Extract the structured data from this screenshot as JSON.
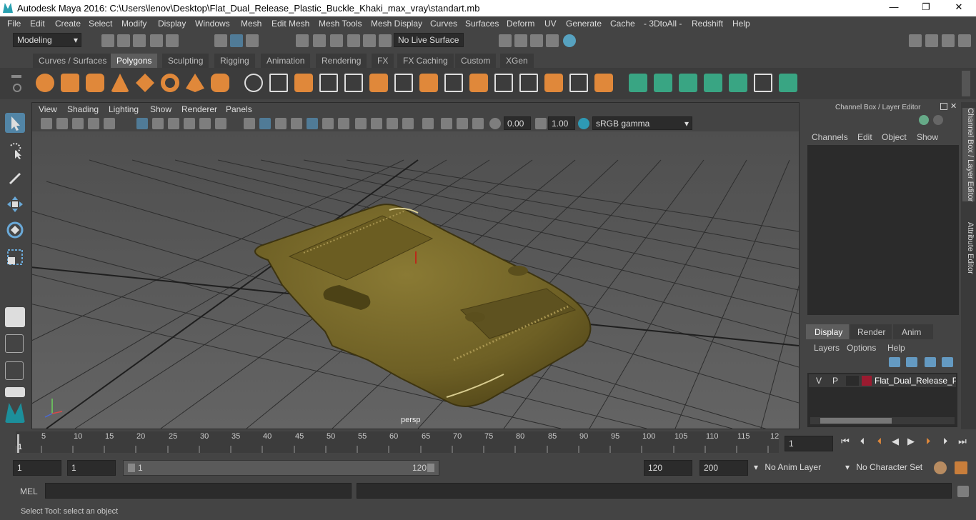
{
  "window": {
    "title": "Autodesk Maya 2016: C:\\Users\\lenov\\Desktop\\Flat_Dual_Release_Plastic_Buckle_Khaki_max_vray\\standart.mb",
    "minimize": "—",
    "restore": "❐",
    "close": "✕"
  },
  "menus": [
    "File",
    "Edit",
    "Create",
    "Select",
    "Modify",
    "Display",
    "Windows",
    "Mesh",
    "Edit Mesh",
    "Mesh Tools",
    "Mesh Display",
    "Curves",
    "Surfaces",
    "Deform",
    "UV",
    "Generate",
    "Cache",
    "- 3DtoAll -",
    "Redshift",
    "Help"
  ],
  "status": {
    "mode": "Modeling",
    "live_surface": "No Live Surface"
  },
  "shelf_tabs": [
    "Curves / Surfaces",
    "Polygons",
    "Sculpting",
    "Rigging",
    "Animation",
    "Rendering",
    "FX",
    "FX Caching",
    "Custom",
    "XGen"
  ],
  "active_shelf_tab": "Polygons",
  "viewport": {
    "menus": [
      "View",
      "Shading",
      "Lighting",
      "Show",
      "Renderer",
      "Panels"
    ],
    "exposure": "0.00",
    "gamma": "1.00",
    "color_space": "sRGB gamma",
    "camera_label": "persp"
  },
  "channel_box": {
    "title": "Channel Box / Layer Editor",
    "menus": [
      "Channels",
      "Edit",
      "Object",
      "Show"
    ]
  },
  "layer_editor": {
    "tabs": [
      "Display",
      "Render",
      "Anim"
    ],
    "menus": [
      "Layers",
      "Options",
      "Help"
    ],
    "layer": {
      "v": "V",
      "p": "P",
      "name": "Flat_Dual_Release_Plas",
      "color": "#9b1b30"
    }
  },
  "side_tabs": [
    "Channel Box / Layer Editor",
    "Attribute Editor"
  ],
  "timeline": {
    "ticks": [
      "5",
      "10",
      "15",
      "20",
      "25",
      "30",
      "35",
      "40",
      "45",
      "50",
      "55",
      "60",
      "65",
      "70",
      "75",
      "80",
      "85",
      "90",
      "95",
      "100",
      "105",
      "110",
      "115",
      "12"
    ],
    "start_marker": "1",
    "current_frame": "1"
  },
  "range": {
    "start": "1",
    "inner_start": "1",
    "slider_start": "1",
    "slider_end": "120",
    "end": "120",
    "outer_end": "200",
    "anim_layer": "No Anim Layer",
    "character_set": "No Character Set"
  },
  "command": {
    "label": "MEL"
  },
  "help_line": "Select Tool: select an object",
  "colors": {
    "buckle": "#7a6b2a",
    "accent": "#5285a6"
  }
}
